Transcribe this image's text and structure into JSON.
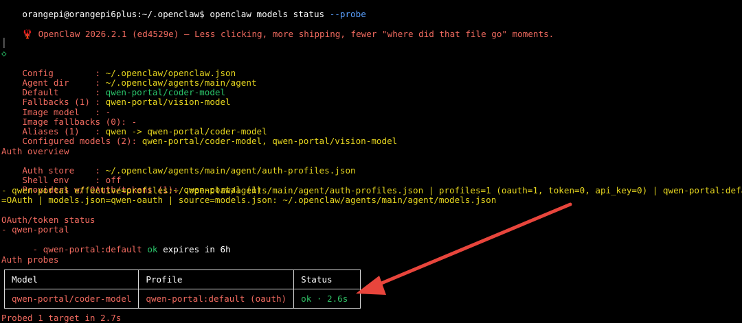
{
  "prompt": {
    "user_host": "orangepi@orangepi6plus",
    "path": ":~/.openclaw$ ",
    "command": "openclaw models status",
    "flag": "--probe"
  },
  "banner": {
    "icon": "🦞",
    "text": " OpenClaw 2026.2.1 (ed4529e) — Less clicking, more shipping, fewer \"where did that file go\" moments."
  },
  "gutter": {
    "bar": "│",
    "diamond": "◇"
  },
  "config": {
    "config_label": "Config        : ",
    "config_value": "~/.openclaw/openclaw.json",
    "agent_dir_label": "Agent dir     : ",
    "agent_dir_value": "~/.openclaw/agents/main/agent",
    "default_label": "Default       : ",
    "default_value": "qwen-portal/coder-model",
    "fallbacks_label": "Fallbacks (1) : ",
    "fallbacks_value": "qwen-portal/vision-model",
    "image_model_label": "Image model   : ",
    "image_model_value": "-",
    "image_fallbacks_label": "Image fallbacks (0): ",
    "image_fallbacks_value": "-",
    "aliases_label": "Aliases (1)   : ",
    "aliases_value": "qwen -> qwen-portal/coder-model",
    "configured_label": "Configured models (2): ",
    "configured_value": "qwen-portal/coder-model, qwen-portal/vision-model"
  },
  "auth": {
    "heading": "Auth overview",
    "store_label": "Auth store    : ",
    "store_value": "~/.openclaw/agents/main/agent/auth-profiles.json",
    "shell_label": "Shell env     : ",
    "shell_value": "off",
    "providers_label": "Providers w/ OAuth/tokens (1): ",
    "providers_value": "qwen-portal (1)",
    "detail_line1": "- qwen-portal effective=profiles:~/.openclaw/agents/main/agent/auth-profiles.json | profiles=1 (oauth=1, token=0, api_key=0) | qwen-portal:default",
    "detail_line2": "=OAuth | models.json=qwen-oauth | source=models.json: ~/.openclaw/agents/main/agent/models.json"
  },
  "oauth_status": {
    "heading": "OAuth/token status",
    "provider": "- qwen-portal",
    "profile_prefix": "  - qwen-portal:default ",
    "ok": "ok",
    "expires": " expires in 6h"
  },
  "probes": {
    "heading": "Auth probes",
    "headers": [
      "Model",
      "Profile",
      "Status"
    ],
    "rows": [
      {
        "model": "qwen-portal/coder-model",
        "profile": "qwen-portal:default (oauth)",
        "status": "ok · 2.6s"
      }
    ],
    "footer": "Probed 1 target in 2.7s"
  },
  "colors": {
    "accent_red": "#f06a5f",
    "accent_yellow": "#e5d51f",
    "accent_green": "#2ac46a",
    "flag_blue": "#5aa0ff",
    "arrow_red": "#e8453c"
  }
}
